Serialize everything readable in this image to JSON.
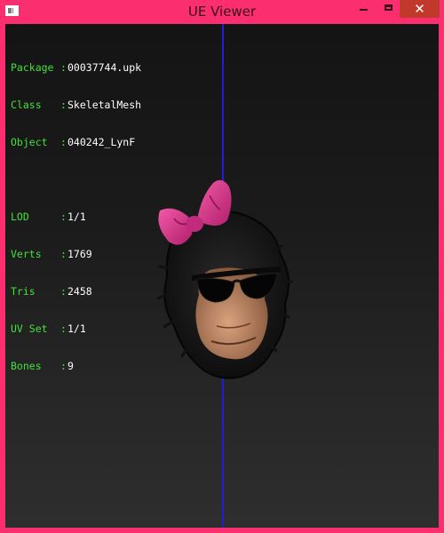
{
  "window": {
    "title": "UE Viewer",
    "close_glyph": "✕"
  },
  "info": {
    "package": {
      "label": "Package",
      "value": "00037744.upk"
    },
    "class": {
      "label": "Class",
      "value": "SkeletalMesh"
    },
    "object": {
      "label": "Object",
      "value": "040242_LynF"
    },
    "lod": {
      "label": "LOD",
      "value": "1/1"
    },
    "verts": {
      "label": "Verts",
      "value": "1769"
    },
    "tris": {
      "label": "Tris",
      "value": "2458"
    },
    "uvset": {
      "label": "UV Set",
      "value": "1/1"
    },
    "bones": {
      "label": "Bones",
      "value": "9"
    }
  },
  "colors": {
    "frame": "#fb2e6f",
    "label_green": "#44e03a",
    "axis_blue": "#1f1fd6",
    "bow_pink": "#e0348e"
  },
  "icons": {
    "app": "window-icon",
    "minimize": "minimize-icon",
    "maximize": "maximize-icon",
    "close": "close-icon"
  }
}
